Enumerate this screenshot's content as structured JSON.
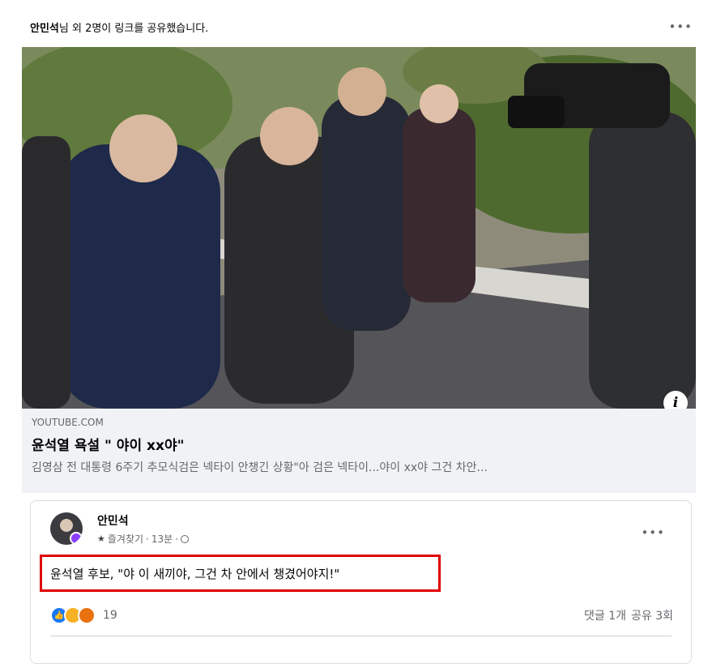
{
  "header": {
    "author": "안민석",
    "text": "님 외 2명이 링크를 공유했습니다.",
    "more_icon": "more-horizontal-icon"
  },
  "link": {
    "domain": "YOUTUBE.COM",
    "title": "윤석열 욕설 \" 야이 xx야\"",
    "description": "김영삼 전 대통령 6주기 추모식검은 넥타이 안챙긴 상황\"아 검은 넥타이...야이 xx야 그건 차안..."
  },
  "shared_post": {
    "author": "안민석",
    "favorite_label": "즐겨찾기",
    "time": "13분",
    "text": "윤석열 후보, \"야 이 새끼야, 그건 차 안에서 챙겼어야지!\"",
    "reaction_count": "19",
    "comments": "댓글 1개",
    "shares": "공유 3회"
  },
  "colors": {
    "highlight_border": "#e00000",
    "like": "#1877f2",
    "link_background": "#f0f2f5"
  }
}
